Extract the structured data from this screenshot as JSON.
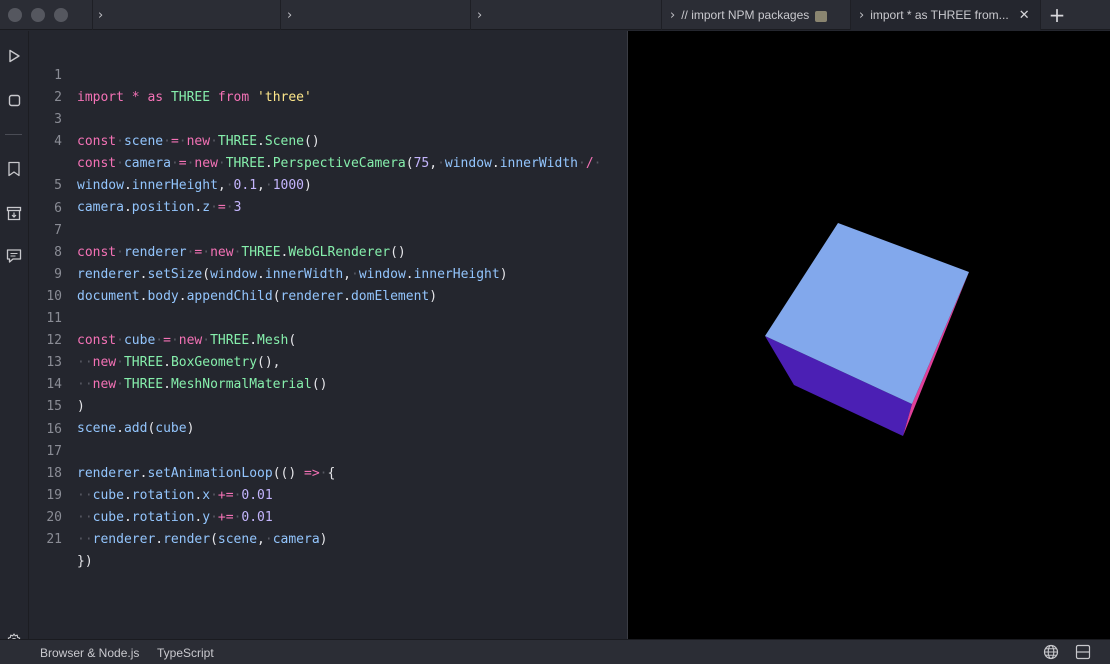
{
  "tabs": [
    {
      "label": "",
      "active": false
    },
    {
      "label": "",
      "active": false
    },
    {
      "label": "",
      "active": false
    },
    {
      "label": "// import NPM packages",
      "active": false
    },
    {
      "label": "import * as THREE from...",
      "active": true
    }
  ],
  "code_lines": [
    {
      "n": "1"
    },
    {
      "n": "2"
    },
    {
      "n": "3"
    },
    {
      "n": "4"
    },
    {
      "n": ""
    },
    {
      "n": "5"
    },
    {
      "n": "6"
    },
    {
      "n": "7"
    },
    {
      "n": "8"
    },
    {
      "n": "9"
    },
    {
      "n": "10"
    },
    {
      "n": "11"
    },
    {
      "n": "12"
    },
    {
      "n": "13"
    },
    {
      "n": "14"
    },
    {
      "n": "15"
    },
    {
      "n": "16"
    },
    {
      "n": "17"
    },
    {
      "n": "18"
    },
    {
      "n": "19"
    },
    {
      "n": "20"
    },
    {
      "n": "21"
    }
  ],
  "code": {
    "l1": {
      "t1": "import",
      "t2": "*",
      "t3": "as",
      "t4": "THREE",
      "t5": "from",
      "t6": "'three'"
    },
    "l3": {
      "t1": "const",
      "t2": "scene",
      "t3": "=",
      "t4": "new",
      "t5": "THREE",
      "t6": ".",
      "t7": "Scene",
      "t8": "()"
    },
    "l4": {
      "t1": "const",
      "t2": "camera",
      "t3": "=",
      "t4": "new",
      "t5": "THREE",
      "t6": ".",
      "t7": "PerspectiveCamera",
      "t8": "(",
      "t9": "75",
      "t10": ",",
      "t11": "window",
      "t12": ".",
      "t13": "innerWidth",
      "t14": "/"
    },
    "l4b": {
      "t1": "window",
      "t2": ".",
      "t3": "innerHeight",
      "t4": ",",
      "t5": "0.1",
      "t6": ",",
      "t7": "1000",
      "t8": ")"
    },
    "l5": {
      "t1": "camera",
      "t2": ".",
      "t3": "position",
      "t4": ".",
      "t5": "z",
      "t6": "=",
      "t7": "3"
    },
    "l7": {
      "t1": "const",
      "t2": "renderer",
      "t3": "=",
      "t4": "new",
      "t5": "THREE",
      "t6": ".",
      "t7": "WebGLRenderer",
      "t8": "()"
    },
    "l8": {
      "t1": "renderer",
      "t2": ".",
      "t3": "setSize",
      "t4": "(",
      "t5": "window",
      "t6": ".",
      "t7": "innerWidth",
      "t8": ",",
      "t9": "window",
      "t10": ".",
      "t11": "innerHeight",
      "t12": ")"
    },
    "l9": {
      "t1": "document",
      "t2": ".",
      "t3": "body",
      "t4": ".",
      "t5": "appendChild",
      "t6": "(",
      "t7": "renderer",
      "t8": ".",
      "t9": "domElement",
      "t10": ")"
    },
    "l11": {
      "t1": "const",
      "t2": "cube",
      "t3": "=",
      "t4": "new",
      "t5": "THREE",
      "t6": ".",
      "t7": "Mesh",
      "t8": "("
    },
    "l12": {
      "t1": "new",
      "t2": "THREE",
      "t3": ".",
      "t4": "BoxGeometry",
      "t5": "(),"
    },
    "l13": {
      "t1": "new",
      "t2": "THREE",
      "t3": ".",
      "t4": "MeshNormalMaterial",
      "t5": "()"
    },
    "l14": {
      "t1": ")"
    },
    "l15": {
      "t1": "scene",
      "t2": ".",
      "t3": "add",
      "t4": "(",
      "t5": "cube",
      "t6": ")"
    },
    "l17": {
      "t1": "renderer",
      "t2": ".",
      "t3": "setAnimationLoop",
      "t4": "(() ",
      "t5": "=>",
      "t6": "{"
    },
    "l18": {
      "t1": "cube",
      "t2": ".",
      "t3": "rotation",
      "t4": ".",
      "t5": "x",
      "t6": "+=",
      "t7": "0.01"
    },
    "l19": {
      "t1": "cube",
      "t2": ".",
      "t3": "rotation",
      "t4": ".",
      "t5": "y",
      "t6": "+=",
      "t7": "0.01"
    },
    "l20": {
      "t1": "renderer",
      "t2": ".",
      "t3": "render",
      "t4": "(",
      "t5": "scene",
      "t6": ",",
      "t7": "camera",
      "t8": ")"
    },
    "l21": {
      "t1": "})"
    }
  },
  "status": {
    "env": "Browser & Node.js",
    "lang": "TypeScript"
  },
  "colors": {
    "keyword": "#f472b6",
    "class": "#86efac",
    "variable": "#93c5fd",
    "string": "#fde68a",
    "number": "#c4b5fd",
    "cube_top": "#82a8ec",
    "cube_side": "#4b1fb4",
    "cube_edge": "#e0409a"
  },
  "icons": {
    "run": "play-icon",
    "stop": "stop-icon",
    "bookmark": "bookmark-icon",
    "install": "install-icon",
    "feedback": "chat-icon",
    "settings": "gear-icon",
    "globe": "globe-icon",
    "layout": "layout-icon"
  }
}
